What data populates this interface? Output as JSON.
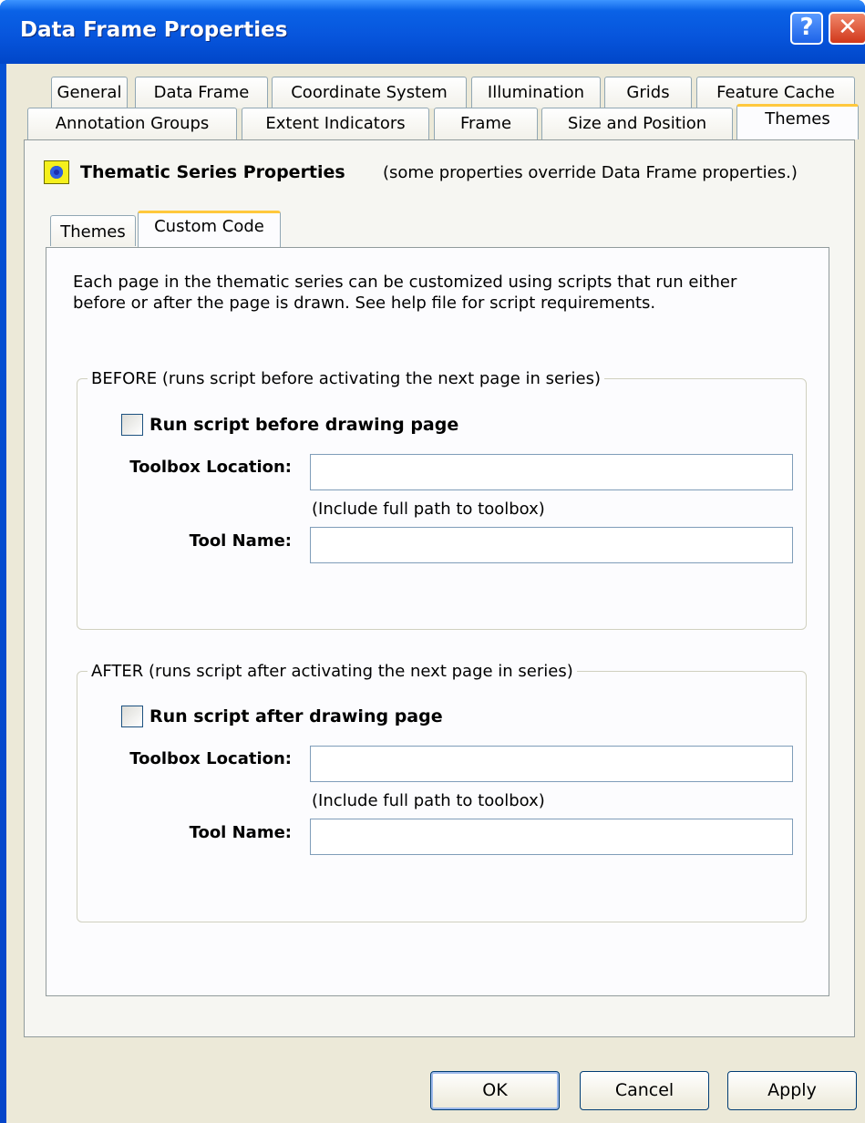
{
  "window": {
    "title": "Data Frame Properties",
    "help_glyph": "?",
    "close_glyph": "✕"
  },
  "tabs_row1": [
    "General",
    "Data Frame",
    "Coordinate System",
    "Illumination",
    "Grids",
    "Feature Cache"
  ],
  "tabs_row2": [
    "Annotation Groups",
    "Extent Indicators",
    "Frame",
    "Size and Position",
    "Themes"
  ],
  "active_tab": "Themes",
  "section": {
    "icon": "thematic-series-icon",
    "title": "Thematic Series Properties",
    "note": "(some properties override Data Frame properties.)"
  },
  "subtabs": [
    "Themes",
    "Custom Code"
  ],
  "active_subtab": "Custom Code",
  "description_line1": "Each page in the thematic series can be customized using scripts that run either",
  "description_line2": "before or after the page is drawn. See help file for script requirements.",
  "before": {
    "legend": "BEFORE (runs script before activating the next page in series)",
    "checkbox_label": "Run script before drawing page",
    "checked": false,
    "toolbox_label": "Toolbox Location:",
    "toolbox_value": "",
    "hint": "(Include full path to toolbox)",
    "tool_label": "Tool Name:",
    "tool_value": ""
  },
  "after": {
    "legend": "AFTER (runs script after activating the next page in series)",
    "checkbox_label": "Run script after drawing page",
    "checked": false,
    "toolbox_label": "Toolbox Location:",
    "toolbox_value": "",
    "hint": "(Include full path to toolbox)",
    "tool_label": "Tool Name:",
    "tool_value": ""
  },
  "buttons": {
    "ok": "OK",
    "cancel": "Cancel",
    "apply": "Apply"
  },
  "colors": {
    "titlebar": "#0a5ddc",
    "client": "#ece9d8",
    "active_tab_accent": "#ffc83c"
  }
}
